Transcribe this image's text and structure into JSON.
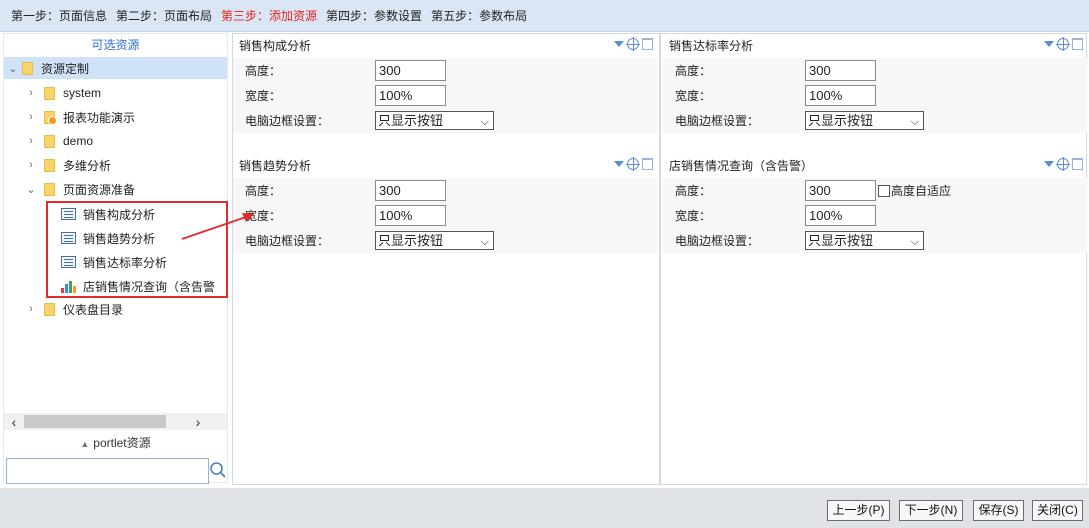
{
  "steps": [
    {
      "label": "第一步：页面信息",
      "active": false
    },
    {
      "label": "第二步：页面布局",
      "active": false
    },
    {
      "label": "第三步：添加资源",
      "active": true
    },
    {
      "label": "第四步：参数设置",
      "active": false
    },
    {
      "label": "第五步：参数布局",
      "active": false
    }
  ],
  "left": {
    "title": "可选资源",
    "tree": {
      "root": "资源定制",
      "system": "system",
      "report_demo": "报表功能演示",
      "demo": "demo",
      "multidim": "多维分析",
      "page_prep": "页面资源准备",
      "item1": "销售构成分析",
      "item2": "销售趋势分析",
      "item3": "销售达标率分析",
      "item4": "店销售情况查询（含告警",
      "dashboard": "仪表盘目录"
    },
    "portlet_label": "portlet资源",
    "search_value": ""
  },
  "portlets": {
    "p1": {
      "title": "销售构成分析",
      "height_label": "高度：",
      "height_value": "300",
      "width_label": "宽度：",
      "width_value": "100%",
      "border_label": "电脑边框设置：",
      "border_value": "只显示按钮"
    },
    "p2": {
      "title": "销售达标率分析",
      "height_label": "高度：",
      "height_value": "300",
      "width_label": "宽度：",
      "width_value": "100%",
      "border_label": "电脑边框设置：",
      "border_value": "只显示按钮"
    },
    "p3": {
      "title": "销售趋势分析",
      "height_label": "高度：",
      "height_value": "300",
      "width_label": "宽度：",
      "width_value": "100%",
      "border_label": "电脑边框设置：",
      "border_value": "只显示按钮"
    },
    "p4": {
      "title": "店销售情况查询（含告警）",
      "height_label": "高度：",
      "height_value": "300",
      "auto_height_label": "高度自适应",
      "width_label": "宽度：",
      "width_value": "100%",
      "border_label": "电脑边框设置：",
      "border_value": "只显示按钮"
    }
  },
  "buttons": {
    "prev": "上一步(P)",
    "next": "下一步(N)",
    "save": "保存(S)",
    "close": "关闭(C)"
  },
  "colors": {
    "active_step": "#e8221b",
    "highlight": "#e62a2a",
    "accent": "#2a6fd6"
  }
}
